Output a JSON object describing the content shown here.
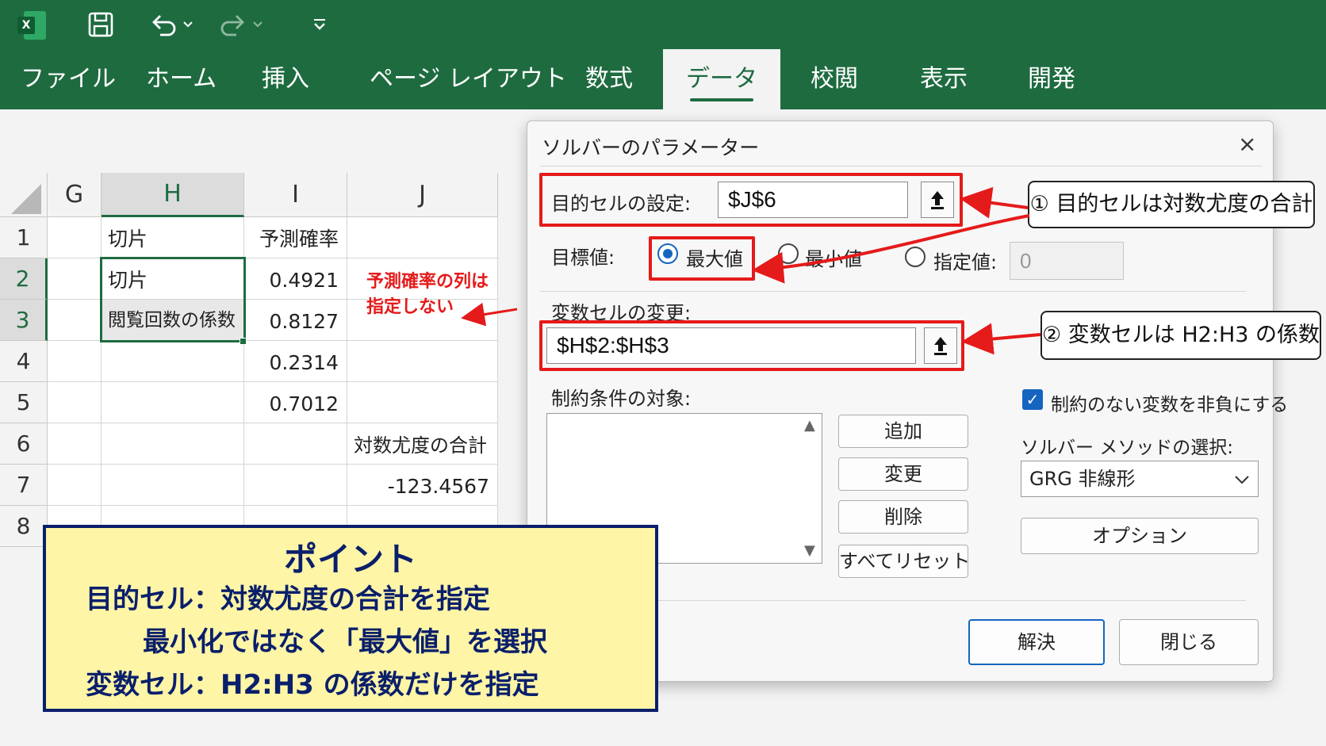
{
  "ribbon": {
    "qat": {
      "app_icon": "excel-icon",
      "app_letter": "X",
      "save": "save-icon",
      "undo": "undo-icon",
      "redo": "redo-icon",
      "customize": "customize-qat-icon"
    },
    "tabs": [
      "ファイル",
      "ホーム",
      "挿入",
      "ページ レイアウト",
      "数式",
      "データ",
      "校閲",
      "表示",
      "開発"
    ],
    "active_tab": "データ",
    "colors": {
      "ribbon": "#1e6b40",
      "accent": "#1e6b40"
    }
  },
  "sheet": {
    "columns": [
      "G",
      "H",
      "I",
      "J"
    ],
    "selected_column": "H",
    "rows": [
      "1",
      "2",
      "3",
      "4",
      "5",
      "6",
      "7",
      "8"
    ],
    "cells": {
      "H1": "切片",
      "I1": "予測確率",
      "H2": "切片",
      "I2": "0.4921",
      "H3": "閲覧回数の係数",
      "I3": "0.8127",
      "I4": "0.2314",
      "I5": "0.7012",
      "J6": "対数尤度の合計",
      "J7": "-123.4567"
    },
    "note": [
      "予測確率の列は",
      "指定しない"
    ]
  },
  "dialog": {
    "title": "ソルバーのパラメーター",
    "close": "×",
    "objective_label": "目的セルの設定:",
    "objective_value": "$J$6",
    "target_label": "目標値:",
    "options": [
      {
        "label": "最大値",
        "selected": true
      },
      {
        "label": "最小値",
        "selected": false
      },
      {
        "label": "指定値:",
        "selected": false
      }
    ],
    "value_of": "0",
    "variable_label": "変数セルの変更:",
    "variable_value": "$H$2:$H$3",
    "constraints_label": "制約条件の対象:",
    "buttons": {
      "add": "追加",
      "change": "変更",
      "delete": "削除",
      "reset": "すべてリセット"
    },
    "nonneg_label": "制約のない変数を非負にする",
    "nonneg_checked": true,
    "method_label": "ソルバー メソッドの選択:",
    "method_value": "GRG 非線形",
    "options_button": "オプション",
    "solve": "解決",
    "close_button": "閉じる"
  },
  "annotations": {
    "callout1": "① 目的セルは対数尤度の合計",
    "callout2": "② 変数セルは H2:H3 の係数",
    "annotation_color": "#e51a1a"
  },
  "point": {
    "title": "ポイント",
    "lines": [
      "目的セル：対数尤度の合計を指定",
      "最小化ではなく「最大値」を選択",
      "変数セル：H2:H3 の係数だけを指定"
    ],
    "colors": {
      "background": "#fff5a6",
      "text": "#0a1f6b"
    }
  }
}
